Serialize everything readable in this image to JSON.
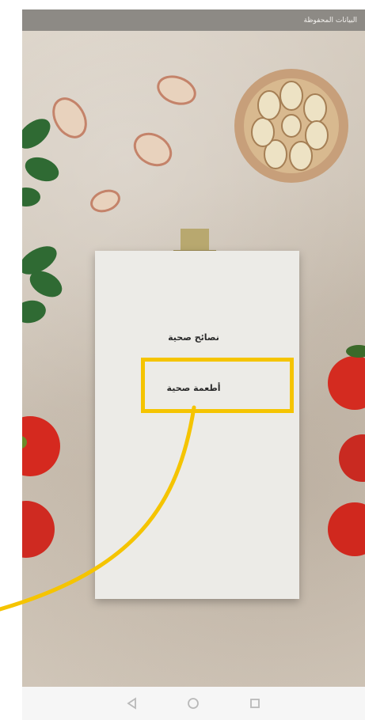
{
  "status_bar": {
    "text": "البيانات المحفوظة"
  },
  "card": {
    "title": "نصائح صحية",
    "highlighted_item": "أطعمة صحية"
  },
  "colors": {
    "highlight": "#f5c400"
  },
  "icons": {
    "back": "triangle-back-icon",
    "home": "home-icon",
    "recents": "recents-square-icon"
  }
}
